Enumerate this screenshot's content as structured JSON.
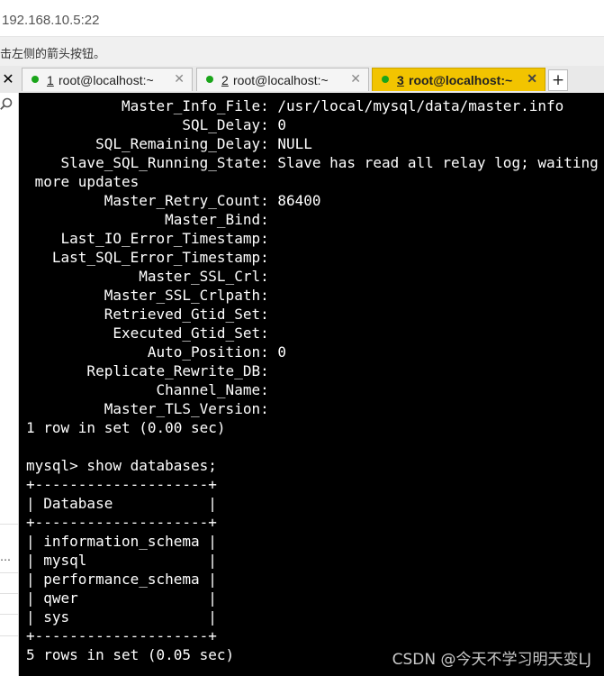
{
  "address_bar": {
    "text": "192.168.10.5:22"
  },
  "hint": {
    "text": "击左侧的箭头按钮。"
  },
  "tabs": [
    {
      "number": "1",
      "label": " root@localhost:~",
      "active": false
    },
    {
      "number": "2",
      "label": " root@localhost:~",
      "active": false
    },
    {
      "number": "3",
      "label": " root@localhost:~",
      "active": true
    }
  ],
  "colors": {
    "active_tab": "#f2c400",
    "session_dot": "#1aa51a",
    "terminal_bg": "#000000"
  },
  "terminal_lines": [
    "           Master_Info_File: /usr/local/mysql/data/master.info",
    "                  SQL_Delay: 0",
    "        SQL_Remaining_Delay: NULL",
    "    Slave_SQL_Running_State: Slave has read all relay log; waiting for",
    " more updates",
    "         Master_Retry_Count: 86400",
    "                Master_Bind:",
    "    Last_IO_Error_Timestamp:",
    "   Last_SQL_Error_Timestamp:",
    "             Master_SSL_Crl:",
    "         Master_SSL_Crlpath:",
    "         Retrieved_Gtid_Set:",
    "          Executed_Gtid_Set:",
    "              Auto_Position: 0",
    "       Replicate_Rewrite_DB:",
    "               Channel_Name:",
    "         Master_TLS_Version:",
    "1 row in set (0.00 sec)",
    "",
    "mysql> show databases;",
    "+--------------------+",
    "| Database           |",
    "+--------------------+",
    "| information_schema |",
    "| mysql              |",
    "| performance_schema |",
    "| qwer               |",
    "| sys                |",
    "+--------------------+",
    "5 rows in set (0.05 sec)"
  ],
  "watermark": "CSDN @今天不学习明天变LJ",
  "icons": {
    "search": "search-icon",
    "close": "close-icon",
    "add_tab": "plus-icon"
  }
}
